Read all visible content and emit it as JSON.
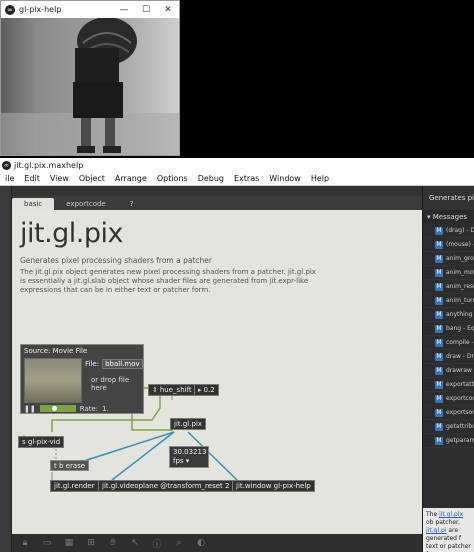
{
  "render_window": {
    "title": "gl-pix-help",
    "icon": "max-logo-icon",
    "minimize": "—",
    "maximize": "☐",
    "close": "✕"
  },
  "patcher_window": {
    "title": "jit.gl.pix.maxhelp",
    "icon": "max-logo-icon"
  },
  "menu": [
    "ile",
    "Edit",
    "View",
    "Object",
    "Arrange",
    "Options",
    "Debug",
    "Extras",
    "Window",
    "Help"
  ],
  "tabs": [
    {
      "label": "basic",
      "active": true
    },
    {
      "label": "exportcode",
      "active": false
    },
    {
      "label": "?",
      "active": false
    }
  ],
  "patch": {
    "title": "jit.gl.pix",
    "subtitle": "Generates pixel processing shaders from a patcher",
    "description": "The jit.gl.pix object generates new pixel processing shaders from a patcher. jit.gl.pix is essentially a jit.gl.slab object whose shader files are generated from jit.expr-like expressions that can be in either text or patcher form.",
    "movie": {
      "source_label": "Source: Movie File",
      "file_label": "File:",
      "file_value": "bball.mov",
      "drop_label": "or drop file here",
      "rate_label": "Rate:",
      "rate_value": "1."
    },
    "objects": {
      "hue_shift": "hue_shift",
      "hue_value": "0.2",
      "pix": "jit.gl.pix",
      "vid": "s gl-pix-vid",
      "t_b_erase": "t b erase",
      "fps_value": "30.03213",
      "fps_label": "fps",
      "render": "jit.gl.render",
      "videoplane": "jit.gl.videoplane @transform_reset 2",
      "window": "jit.window gl-pix-help"
    }
  },
  "sidebar": {
    "header": "Generates pixel",
    "messages_label": "Messages",
    "items": [
      "(drag) - Dra",
      "(mouse) - C",
      "anim_grow",
      "anim_move",
      "anim_reset",
      "anim_turn",
      "anything",
      "bang - Equi",
      "compile - C",
      "draw - Draw",
      "drawraw -",
      "exportattrib",
      "exportcode",
      "exportsome",
      "getattribute",
      "getparamde"
    ],
    "desc_a": "The ",
    "desc_link1": "jit.gl.pix",
    "desc_b": " ob patcher. ",
    "desc_link2": "jit.gl.pi",
    "desc_c": " are generated f text or patcher f"
  },
  "bottom_icons": [
    "lock-icon",
    "presentation-icon",
    "grid-icon",
    "new-object-icon",
    "hand-icon",
    "pointer-icon",
    "inspector-icon",
    "zoom-icon",
    "palette-icon"
  ]
}
